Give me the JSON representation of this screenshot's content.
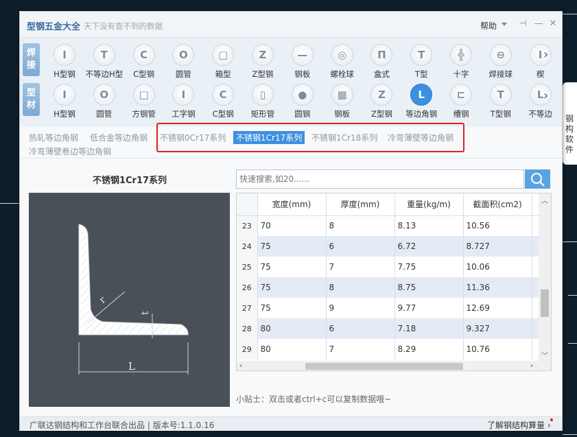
{
  "window": {
    "title": "型钢五金大全",
    "slogan": "天下没有查不到的数据",
    "help_label": "帮助"
  },
  "rows": {
    "weld_tag": "焊接",
    "profile_tag": "型材",
    "weld_items": [
      {
        "label": "H型钢",
        "icon": "I"
      },
      {
        "label": "不等边H型",
        "icon": "T"
      },
      {
        "label": "C型钢",
        "icon": "C"
      },
      {
        "label": "圆管",
        "icon": "O"
      },
      {
        "label": "箱型",
        "icon": "▢"
      },
      {
        "label": "Z型钢",
        "icon": "Z"
      },
      {
        "label": "钢板",
        "icon": "—"
      },
      {
        "label": "螺栓球",
        "icon": "◎"
      },
      {
        "label": "盒式",
        "icon": "Π"
      },
      {
        "label": "T型",
        "icon": "T"
      },
      {
        "label": "十字",
        "icon": "╬"
      },
      {
        "label": "焊接球",
        "icon": "⊖"
      },
      {
        "label": "楔",
        "icon": "I"
      }
    ],
    "profile_items": [
      {
        "label": "H型钢",
        "icon": "I"
      },
      {
        "label": "圆管",
        "icon": "O"
      },
      {
        "label": "方钢管",
        "icon": "□"
      },
      {
        "label": "工字钢",
        "icon": "I"
      },
      {
        "label": "C型钢",
        "icon": "C"
      },
      {
        "label": "矩形管",
        "icon": "▯"
      },
      {
        "label": "圆钢",
        "icon": "●"
      },
      {
        "label": "钢板",
        "icon": "▦"
      },
      {
        "label": "Z型钢",
        "icon": "Z"
      },
      {
        "label": "等边角钢",
        "icon": "L"
      },
      {
        "label": "槽钢",
        "icon": "⊏"
      },
      {
        "label": "T型钢",
        "icon": "T"
      },
      {
        "label": "不等边",
        "icon": "L"
      }
    ]
  },
  "subtabs": [
    "热轧等边角钢",
    "低合金等边角钢",
    "不锈钢0Cr17系列",
    "不锈钢1Cr17系列",
    "不锈钢1Cr18系列",
    "冷弯薄壁等边角钢",
    "冷弯薄壁卷边等边角钢"
  ],
  "panel": {
    "title": "不锈钢1Cr17系列",
    "diagram_labels": {
      "r": "r",
      "t": "t",
      "L": "L"
    }
  },
  "search": {
    "placeholder": "快速搜索,如20......"
  },
  "table": {
    "columns": [
      "宽度(mm)",
      "厚度(mm)",
      "重量(kg/m)",
      "截面积(cm2)"
    ],
    "rows": [
      {
        "n": "23",
        "cells": [
          "70",
          "8",
          "8.13",
          "10.56"
        ]
      },
      {
        "n": "24",
        "cells": [
          "75",
          "6",
          "6.72",
          "8.727"
        ]
      },
      {
        "n": "25",
        "cells": [
          "75",
          "7",
          "7.75",
          "10.06"
        ]
      },
      {
        "n": "26",
        "cells": [
          "75",
          "8",
          "8.75",
          "11.36"
        ]
      },
      {
        "n": "27",
        "cells": [
          "75",
          "9",
          "9.77",
          "12.69"
        ]
      },
      {
        "n": "28",
        "cells": [
          "80",
          "6",
          "7.18",
          "9.327"
        ]
      },
      {
        "n": "29",
        "cells": [
          "80",
          "7",
          "8.29",
          "10.76"
        ]
      }
    ]
  },
  "tip": "小贴士：双击或者ctrl+c可以复制数据哦~",
  "footer": {
    "credit": "广联达钢结构和工作台联合出品",
    "version": "版本号:1.1.0.16",
    "link": "了解钢结构算量"
  },
  "side_badge": "钢构软件",
  "colors": {
    "accent": "#3d8fe0",
    "highlight_box": "#e02020",
    "alt_row": "#e5ebf5"
  }
}
